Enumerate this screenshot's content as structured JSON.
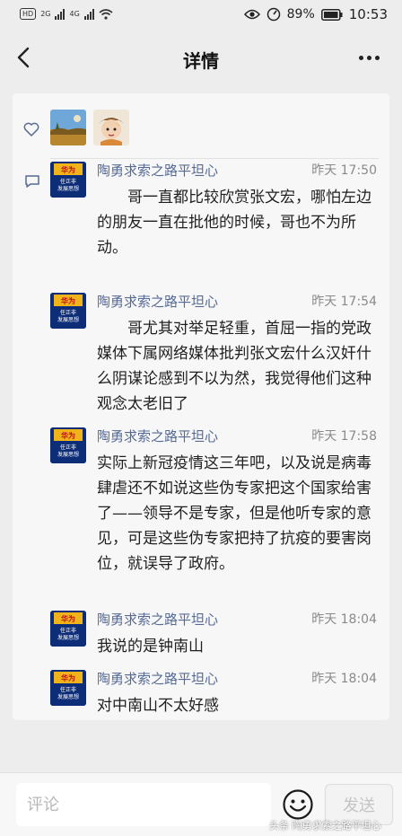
{
  "status_bar": {
    "hd": "HD",
    "net1": "2G",
    "net2": "4G",
    "battery": "89%",
    "time": "10:53"
  },
  "nav": {
    "title": "详情",
    "back_icon": "chevron-left-icon",
    "more_icon": "more-horizontal-icon"
  },
  "likes": {
    "icon": "heart-icon",
    "avatars": [
      "landscape-avatar",
      "cartoon-avatar"
    ]
  },
  "comments_icon": "comment-icon",
  "comments": [
    {
      "name": "陶勇求索之路平坦心",
      "time": "昨天 17:50",
      "text": "　　哥一直都比较欣赏张文宏，哪怕左边的朋友一直在批他的时候，哥也不为所动。"
    },
    {
      "name": "陶勇求索之路平坦心",
      "time": "昨天 17:54",
      "text": "　　哥尤其对举足轻重，首屈一指的党政媒体下属网络媒体批判张文宏什么汉奸什么阴谋论感到不以为然，我觉得他们这种观念太老旧了"
    },
    {
      "name": "陶勇求索之路平坦心",
      "time": "昨天 17:58",
      "text": "实际上新冠疫情这三年吧，以及说是病毒肆虐还不如说这些伪专家把这个国家给害了——领导不是专家，但是他听专家的意见，可是这些伪专家把持了抗疫的要害岗位，就误导了政府。"
    },
    {
      "name": "陶勇求索之路平坦心",
      "time": "昨天 18:04",
      "text": "我说的是钟南山"
    },
    {
      "name": "陶勇求索之路平坦心",
      "time": "昨天 18:04",
      "text": "对中南山不太好感"
    }
  ],
  "avatar_book": {
    "line1": "华为",
    "line2": "任正非",
    "line3": "发展思想"
  },
  "bottom": {
    "placeholder": "评论",
    "emoji_icon": "emoji-icon",
    "send_label": "发送",
    "watermark": "头条 陶勇求索之路平坦心"
  },
  "colors": {
    "name": "#566a94",
    "background": "#ededed",
    "card": "#f7f7f7"
  }
}
